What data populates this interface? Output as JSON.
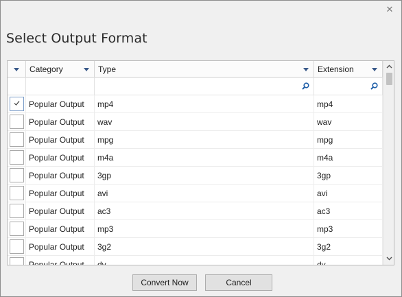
{
  "dialog": {
    "title": "Select Output Format",
    "close_glyph": "✕"
  },
  "grid": {
    "columns": [
      {
        "label": ""
      },
      {
        "label": "Category"
      },
      {
        "label": "Type"
      },
      {
        "label": "Extension"
      }
    ],
    "rows": [
      {
        "category": "Popular Output",
        "type": "mp4",
        "extension": "mp4",
        "checked": true
      },
      {
        "category": "Popular Output",
        "type": "wav",
        "extension": "wav",
        "checked": false
      },
      {
        "category": "Popular Output",
        "type": "mpg",
        "extension": "mpg",
        "checked": false
      },
      {
        "category": "Popular Output",
        "type": "m4a",
        "extension": "m4a",
        "checked": false
      },
      {
        "category": "Popular Output",
        "type": "3gp",
        "extension": "3gp",
        "checked": false
      },
      {
        "category": "Popular Output",
        "type": "avi",
        "extension": "avi",
        "checked": false
      },
      {
        "category": "Popular Output",
        "type": "ac3",
        "extension": "ac3",
        "checked": false
      },
      {
        "category": "Popular Output",
        "type": "mp3",
        "extension": "mp3",
        "checked": false
      },
      {
        "category": "Popular Output",
        "type": "3g2",
        "extension": "3g2",
        "checked": false
      },
      {
        "category": "Popular Output",
        "type": "dv",
        "extension": "dv",
        "checked": false
      }
    ]
  },
  "buttons": {
    "convert_label": "Convert Now",
    "cancel_label": "Cancel"
  },
  "icons": {
    "close": "close-icon",
    "column_menu": "caret-down-icon",
    "filter_search": "search-icon",
    "checkbox_tick": "checkmark-icon",
    "scroll_up": "chevron-up-icon",
    "scroll_down": "chevron-down-icon"
  },
  "colors": {
    "dialog_bg": "#f0f0f0",
    "grid_bg": "#ffffff",
    "accent": "#3a5a8a",
    "search_icon": "#1f5fa8"
  }
}
